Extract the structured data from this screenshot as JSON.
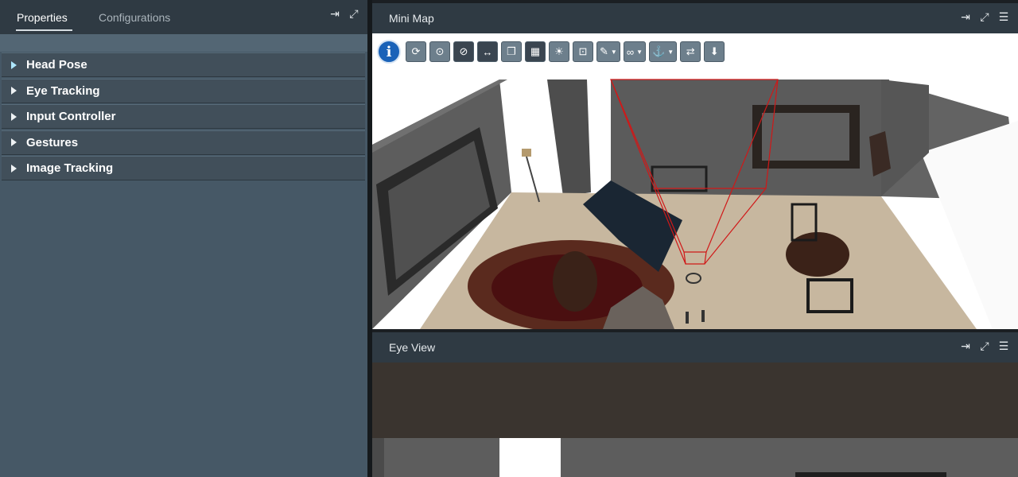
{
  "left_panel": {
    "tabs": [
      {
        "label": "Properties",
        "active": true
      },
      {
        "label": "Configurations",
        "active": false
      }
    ],
    "accordion": [
      {
        "label": "Head Pose"
      },
      {
        "label": "Eye Tracking"
      },
      {
        "label": "Input Controller"
      },
      {
        "label": "Gestures"
      },
      {
        "label": "Image Tracking"
      }
    ],
    "header_icons": [
      "pin-icon",
      "expand-icon"
    ]
  },
  "mini_map": {
    "title": "Mini Map",
    "header_icons": [
      "pin-icon",
      "expand-icon",
      "menu-icon"
    ],
    "toolbar": [
      "info-icon",
      "camera-rotate-icon",
      "camera-orbit-icon",
      "hide-visibility-icon",
      "ruler-icon",
      "layers-icon",
      "grid-toggle-icon",
      "lighting-icon",
      "focus-icon",
      "edit-dropdown-icon",
      "link-dropdown-icon",
      "anchor-dropdown-icon",
      "refresh-icon",
      "download-icon"
    ]
  },
  "eye_view": {
    "title": "Eye View",
    "header_icons": [
      "pin-icon",
      "expand-icon",
      "menu-icon"
    ]
  },
  "colors": {
    "panel_bg": "#465866",
    "header_bg": "#2f3a43",
    "accent_info": "#1a62b8",
    "frustum_red": "#d01818"
  }
}
